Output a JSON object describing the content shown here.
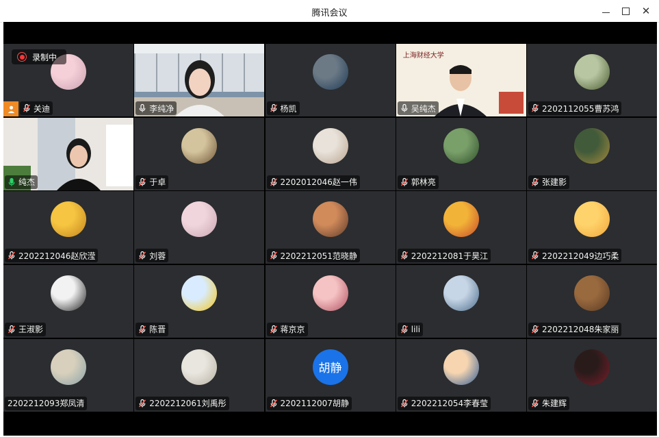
{
  "window": {
    "title": "腾讯会议"
  },
  "recording": {
    "label": "录制中"
  },
  "participants": [
    {
      "name": "关迪",
      "mic": "muted",
      "badge": true
    },
    {
      "name": "李纯净",
      "mic": "on",
      "video": "woman-window"
    },
    {
      "name": "杨凯",
      "mic": "muted"
    },
    {
      "name": "吴纯杰",
      "mic": "on",
      "video": "man-lecture"
    },
    {
      "name": "2202112055曹苏鸿",
      "mic": "muted"
    },
    {
      "name": "纯杰",
      "mic": "on-green",
      "video": "woman-room",
      "active": true
    },
    {
      "name": "于卓",
      "mic": "muted"
    },
    {
      "name": "2202012046赵一伟",
      "mic": "muted"
    },
    {
      "name": "郭林亮",
      "mic": "muted"
    },
    {
      "name": "张建影",
      "mic": "muted"
    },
    {
      "name": "2202212046赵欣滢",
      "mic": "muted"
    },
    {
      "name": "刘蓉",
      "mic": "muted"
    },
    {
      "name": "2202212051范晓静",
      "mic": "muted"
    },
    {
      "name": "2202212081于昊江",
      "mic": "muted"
    },
    {
      "name": "2202212049边巧柔",
      "mic": "muted"
    },
    {
      "name": "王淑影",
      "mic": "muted"
    },
    {
      "name": "陈晋",
      "mic": "muted"
    },
    {
      "name": "蒋京京",
      "mic": "muted"
    },
    {
      "name": "lili",
      "mic": "muted"
    },
    {
      "name": "2202212048朱家丽",
      "mic": "muted"
    },
    {
      "name": "2202212093郑凤清",
      "mic": "none"
    },
    {
      "name": "2202212061刘禹彤",
      "mic": "muted"
    },
    {
      "name": "2202112007胡静",
      "mic": "muted",
      "avatar_text": "胡静"
    },
    {
      "name": "2202212054李春莹",
      "mic": "muted"
    },
    {
      "name": "朱建辉",
      "mic": "muted"
    }
  ],
  "lecture_logo": "上海财经大学",
  "colors": {
    "accent": "#2bbd5b",
    "muted": "#ff5a4f",
    "brand_blue": "#1a73e8"
  }
}
